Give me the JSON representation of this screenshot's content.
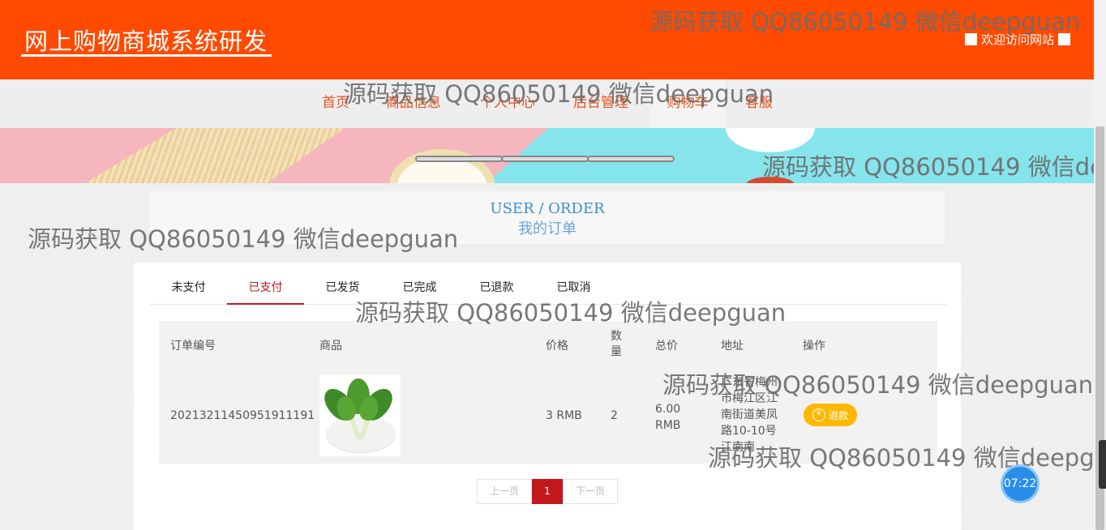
{
  "header": {
    "site_title": "网上购物商城系统研发",
    "welcome": "欢迎访问网站"
  },
  "nav": {
    "items": [
      "首页",
      "商品信息",
      "个人中心",
      "后台管理",
      "购物车",
      "客服"
    ],
    "active": "购物车"
  },
  "section_title": {
    "en": "USER / ORDER",
    "zh": "我的订单"
  },
  "tabs": {
    "items": [
      "未支付",
      "已支付",
      "已发货",
      "已完成",
      "已退款",
      "已取消"
    ],
    "active": "已支付"
  },
  "table": {
    "headers": {
      "order_no": "订单编号",
      "product": "商品",
      "price": "价格",
      "qty": "数量",
      "total": "总价",
      "address": "地址",
      "action": "操作"
    },
    "rows": [
      {
        "order_no": "20213211450951911191",
        "price": "3 RMB",
        "qty": "2",
        "total": "6.00 RMB",
        "address": "广东省梅州市梅江区江南街道美凤路10-10号江南南",
        "action_label": "退款",
        "action_icon": "yen-coin-icon"
      }
    ]
  },
  "pager": {
    "prev": "上一页",
    "current": "1",
    "next": "下一页"
  },
  "timer": "07:22",
  "watermark": "源码获取 QQ86050149 微信deepguan",
  "colors": {
    "header_bg": "#ff4a00",
    "nav_text": "#e9541e",
    "accent_red": "#c3171c",
    "refund_btn": "#ffb800",
    "title_blue": "#3b8ed0"
  }
}
